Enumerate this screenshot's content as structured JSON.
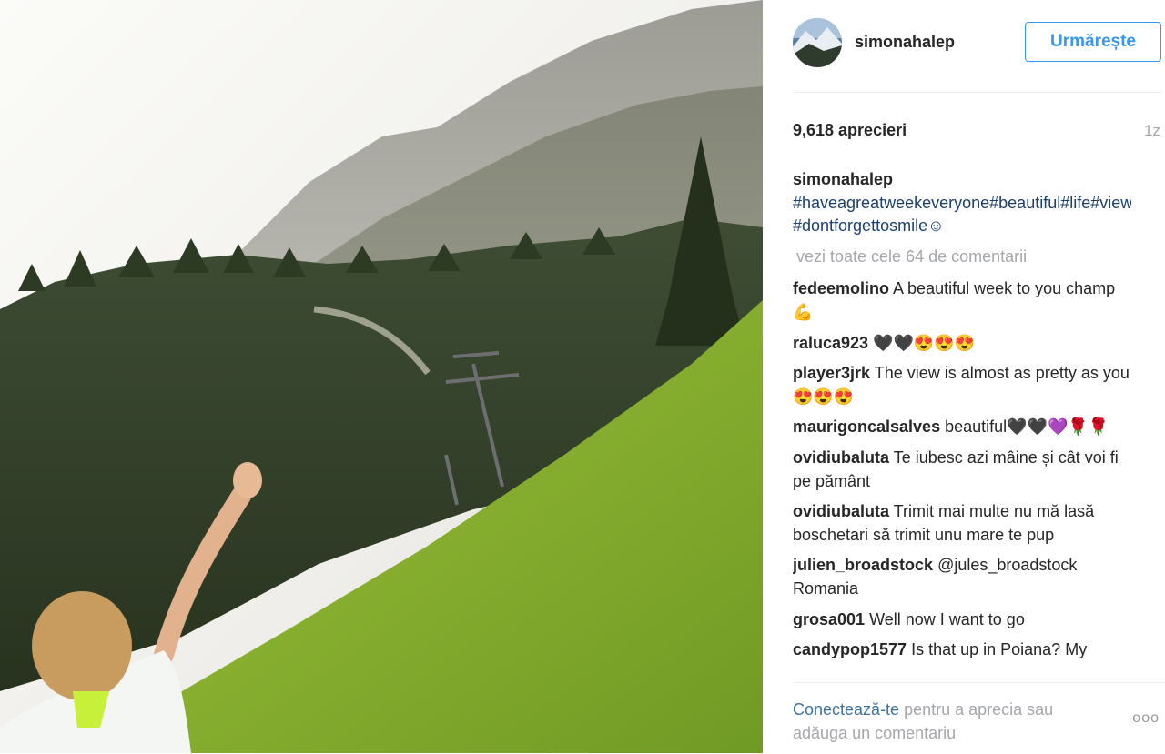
{
  "post": {
    "username": "simonahalep",
    "follow_label": "Urmărește",
    "likes": "9,618 aprecieri",
    "age": "1z",
    "caption": {
      "username": "simonahalep",
      "text": "#haveagreatweekeveryone#beautiful#life#view#romania#walking #dontforgettosmile☺"
    },
    "view_all_comments": "vezi toate cele 64 de comentarii"
  },
  "comments": [
    {
      "user": "fedeemolino",
      "text": "A beautiful week to you champ💪"
    },
    {
      "user": "raluca923",
      "text": "🖤🖤😍😍😍"
    },
    {
      "user": "player3jrk",
      "text": "The view is almost as pretty as you 😍😍😍"
    },
    {
      "user": "maurigoncalsalves",
      "text": "beautiful🖤🖤💜🌹🌹"
    },
    {
      "user": "ovidiubaluta",
      "text": "Te iubesc azi mâine și cât voi fi pe pământ"
    },
    {
      "user": "ovidiubaluta",
      "text": "Trimit mai multe nu mă lasă boschetari să trimit unu mare te pup"
    },
    {
      "user": "julien_broadstock",
      "text": "@jules_broadstock Romania"
    },
    {
      "user": "grosa001",
      "text": "Well now I want to go"
    },
    {
      "user": "candypop1577",
      "text": "Is that up in Poiana? My"
    }
  ],
  "footer": {
    "login_link": "Conectează-te",
    "rest": " pentru a aprecia sau adăuga un comentariu",
    "more_options": "ooo"
  },
  "icons": {
    "avatar": "avatar",
    "more": "more-options-icon"
  }
}
